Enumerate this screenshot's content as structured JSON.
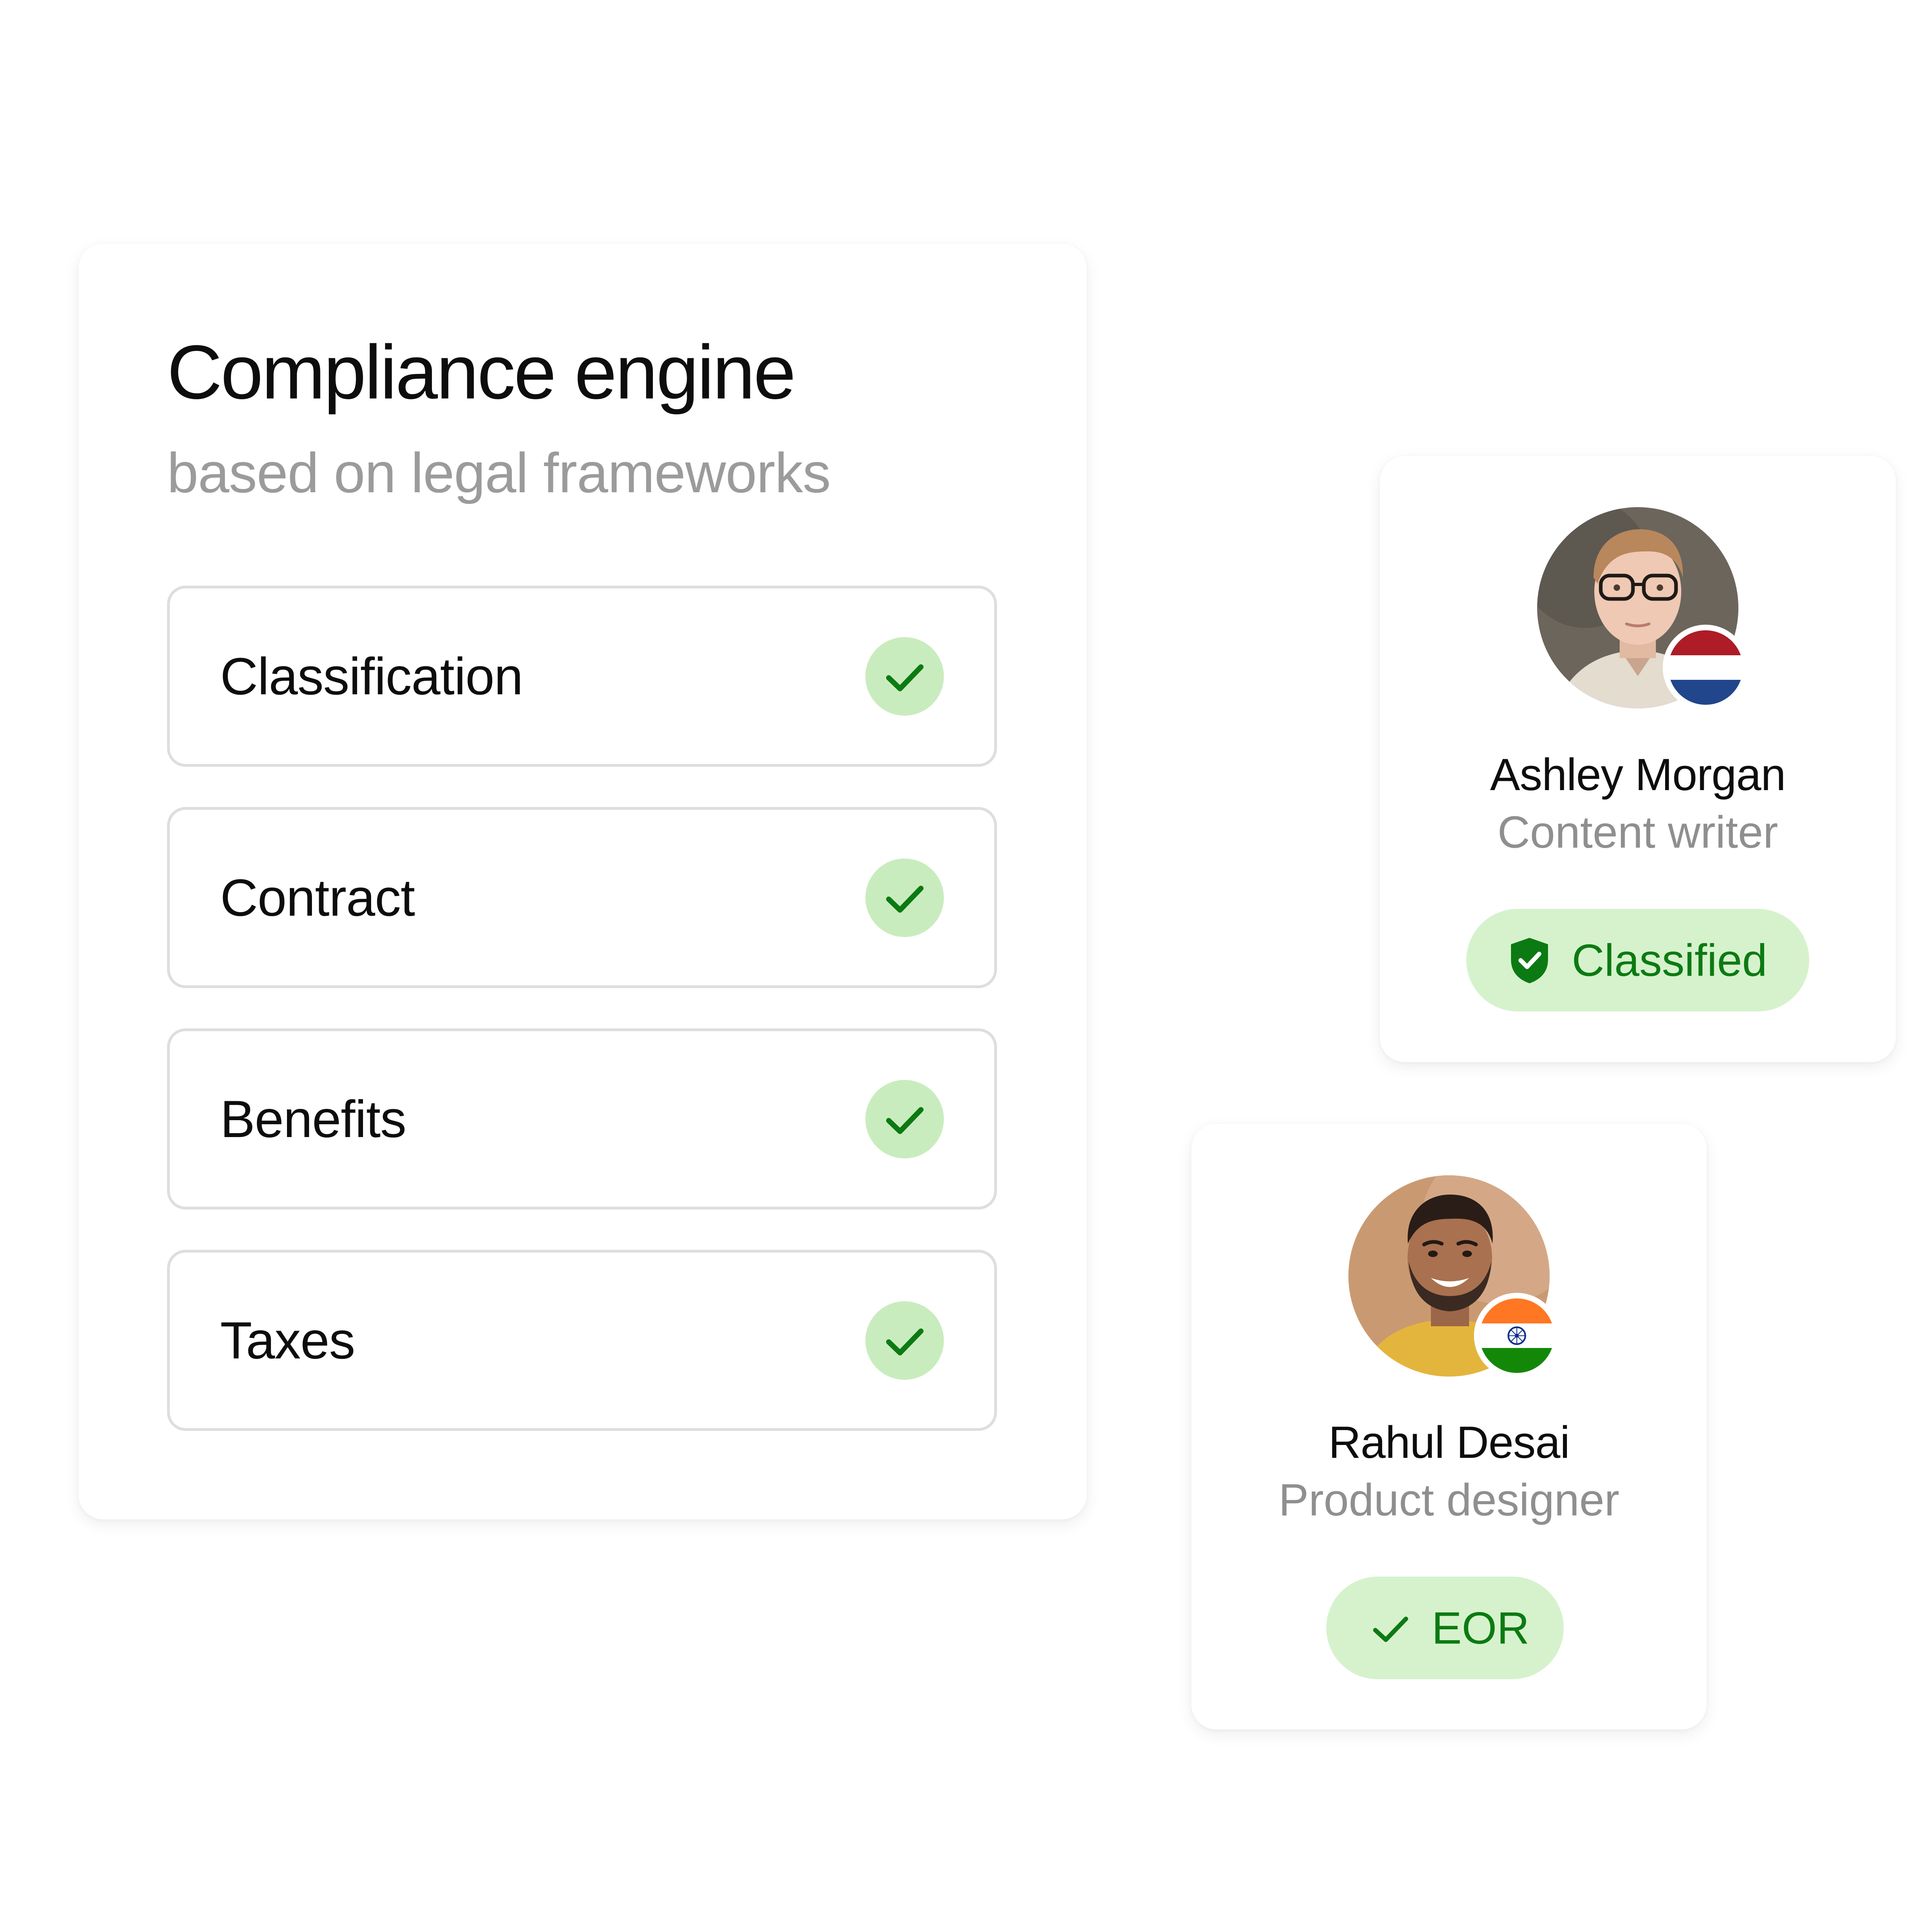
{
  "compliance": {
    "title": "Compliance engine",
    "subtitle": "based on legal frameworks",
    "items": [
      {
        "label": "Classification",
        "status": "checked"
      },
      {
        "label": "Contract",
        "status": "checked"
      },
      {
        "label": "Benefits",
        "status": "checked"
      },
      {
        "label": "Taxes",
        "status": "checked"
      }
    ]
  },
  "people": [
    {
      "name": "Ashley Morgan",
      "role": "Content writer",
      "flag": "netherlands-flag-icon",
      "status": {
        "label": "Classified",
        "icon": "shield-check-icon"
      }
    },
    {
      "name": "Rahul Desai",
      "role": "Product designer",
      "flag": "india-flag-icon",
      "status": {
        "label": "EOR",
        "icon": "checkmark-icon"
      }
    }
  ],
  "colors": {
    "check_bg": "#c9ecbe",
    "check_stroke": "#0c7a12",
    "pill_bg": "#d6f2cd",
    "pill_text": "#0c7a12",
    "subtitle_gray": "#9b9b9b"
  }
}
